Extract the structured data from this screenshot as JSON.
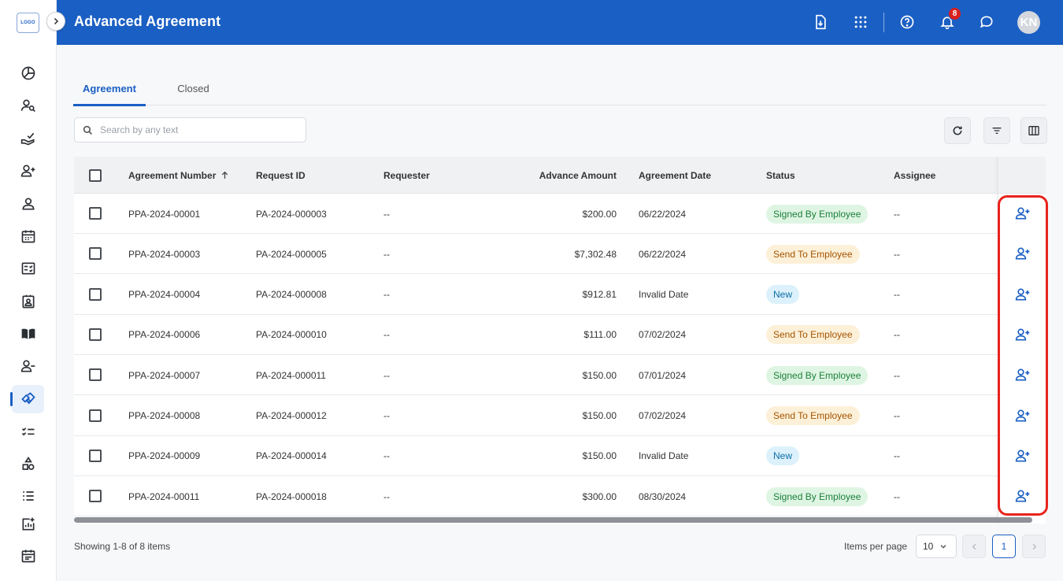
{
  "sidebar": {
    "logo": "LOGO",
    "items": [
      {
        "name": "dashboard-icon"
      },
      {
        "name": "user-search-icon"
      },
      {
        "name": "hand-check-icon"
      },
      {
        "name": "user-add-icon"
      },
      {
        "name": "person-icon"
      },
      {
        "name": "calendar-icon"
      },
      {
        "name": "checklist-icon"
      },
      {
        "name": "contact-card-icon"
      },
      {
        "name": "book-icon"
      },
      {
        "name": "user-remove-icon"
      },
      {
        "name": "handshake-icon",
        "active": true
      },
      {
        "name": "task-list-icon"
      },
      {
        "name": "shapes-icon"
      },
      {
        "name": "list-check-icon"
      },
      {
        "name": "report-chart-icon"
      },
      {
        "name": "event-calendar-icon"
      }
    ]
  },
  "header": {
    "title": "Advanced Agreement",
    "notification_count": "8",
    "avatar_initials": "KN"
  },
  "tabs": [
    {
      "label": "Agreement",
      "active": true
    },
    {
      "label": "Closed",
      "active": false
    }
  ],
  "search": {
    "placeholder": "Search by any text",
    "value": ""
  },
  "table": {
    "columns": {
      "agreement_number": "Agreement Number",
      "request_id": "Request ID",
      "requester": "Requester",
      "advance_amount": "Advance Amount",
      "agreement_date": "Agreement Date",
      "status": "Status",
      "assignee": "Assignee"
    },
    "rows": [
      {
        "agreement_number": "PPA-2024-00001",
        "request_id": "PA-2024-000003",
        "requester": "--",
        "advance_amount": "$200.00",
        "agreement_date": "06/22/2024",
        "status": "Signed By Employee",
        "status_type": "signed",
        "assignee": "--"
      },
      {
        "agreement_number": "PPA-2024-00003",
        "request_id": "PA-2024-000005",
        "requester": "--",
        "advance_amount": "$7,302.48",
        "agreement_date": "06/22/2024",
        "status": "Send To Employee",
        "status_type": "send",
        "assignee": "--"
      },
      {
        "agreement_number": "PPA-2024-00004",
        "request_id": "PA-2024-000008",
        "requester": "--",
        "advance_amount": "$912.81",
        "agreement_date": "Invalid Date",
        "status": "New",
        "status_type": "new",
        "assignee": "--"
      },
      {
        "agreement_number": "PPA-2024-00006",
        "request_id": "PA-2024-000010",
        "requester": "--",
        "advance_amount": "$111.00",
        "agreement_date": "07/02/2024",
        "status": "Send To Employee",
        "status_type": "send",
        "assignee": "--"
      },
      {
        "agreement_number": "PPA-2024-00007",
        "request_id": "PA-2024-000011",
        "requester": "--",
        "advance_amount": "$150.00",
        "agreement_date": "07/01/2024",
        "status": "Signed By Employee",
        "status_type": "signed",
        "assignee": "--"
      },
      {
        "agreement_number": "PPA-2024-00008",
        "request_id": "PA-2024-000012",
        "requester": "--",
        "advance_amount": "$150.00",
        "agreement_date": "07/02/2024",
        "status": "Send To Employee",
        "status_type": "send",
        "assignee": "--"
      },
      {
        "agreement_number": "PPA-2024-00009",
        "request_id": "PA-2024-000014",
        "requester": "--",
        "advance_amount": "$150.00",
        "agreement_date": "Invalid Date",
        "status": "New",
        "status_type": "new",
        "assignee": "--"
      },
      {
        "agreement_number": "PPA-2024-00011",
        "request_id": "PA-2024-000018",
        "requester": "--",
        "advance_amount": "$300.00",
        "agreement_date": "08/30/2024",
        "status": "Signed By Employee",
        "status_type": "signed",
        "assignee": "--"
      }
    ]
  },
  "footer": {
    "showing": "Showing 1-8 of 8 items",
    "items_per_page_label": "Items per page",
    "items_per_page": "10",
    "current_page": "1"
  },
  "colors": {
    "primary": "#1a5fc4",
    "highlight": "#e8231c",
    "badge_signed_bg": "#dff5e3",
    "badge_send_bg": "#fdf0d8",
    "badge_new_bg": "#dcf1fb"
  }
}
